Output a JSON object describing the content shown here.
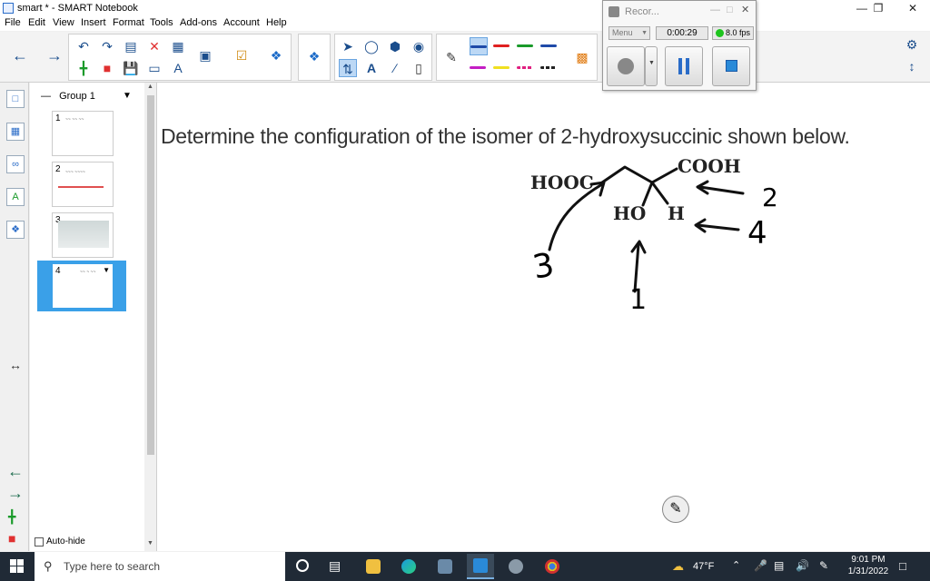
{
  "window": {
    "title": "smart * - SMART Notebook",
    "minimize": "—",
    "restore": "❐",
    "close": "✕"
  },
  "menu": [
    "File",
    "Edit",
    "View",
    "Insert",
    "Format",
    "Tools",
    "Add-ons",
    "Account",
    "Help"
  ],
  "sidebar": {
    "group_label": "Group 1",
    "auto_hide_label": "Auto-hide",
    "pages": [
      {
        "num": "1",
        "scribble": "~~ ~~ ~~"
      },
      {
        "num": "2",
        "scribble": "~~~ ~~~~"
      },
      {
        "num": "3",
        "scribble": "~~~~~~~~"
      },
      {
        "num": "4",
        "scribble": "~~ ~ ~~"
      }
    ]
  },
  "canvas": {
    "question": "Determine the configuration of the isomer of 2-hydroxysuccinic shown below.",
    "molecule": {
      "left_group": "HOOC",
      "right_group": "COOH",
      "hydroxyl": "HO",
      "hydrogen": "H"
    },
    "annotations": {
      "n1": "1",
      "n2": "2",
      "n3": "3",
      "n4": "4"
    }
  },
  "recorder": {
    "title": "Recor...",
    "menu_label": "Menu",
    "timer": "0:00:29",
    "fps": "8.0 fps"
  },
  "taskbar": {
    "search_placeholder": "Type here to search",
    "weather": "47°F",
    "time": "9:01 PM",
    "date": "1/31/2022"
  },
  "colors": {
    "accent": "#2a6cc8",
    "pen_colors": [
      "#1f4aa8",
      "#e02020",
      "#1a9a2a",
      "#1f4aa8",
      "#c41ec4",
      "#f0e020",
      "#e02080",
      "#222222"
    ],
    "fps_indicator": "#1ec41e",
    "selected_page": "#3aa0e8"
  }
}
